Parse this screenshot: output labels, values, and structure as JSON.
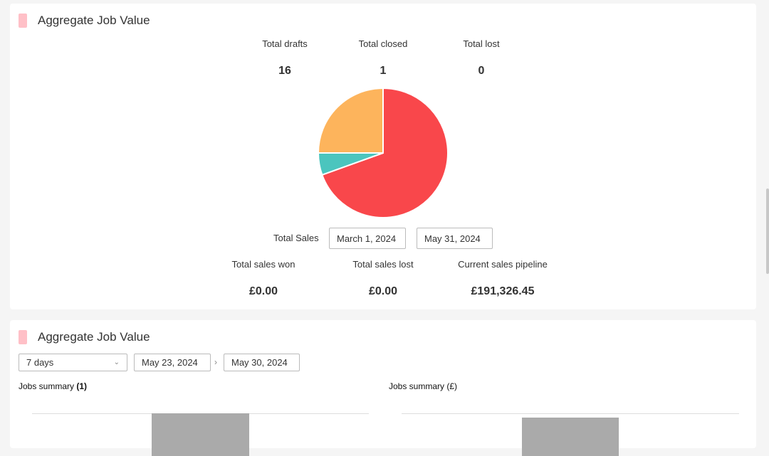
{
  "card1": {
    "title": "Aggregate Job Value",
    "stats": [
      {
        "label": "Total drafts",
        "value": "16"
      },
      {
        "label": "Total closed",
        "value": "1"
      },
      {
        "label": "Total lost",
        "value": "0"
      }
    ],
    "sales": {
      "label": "Total Sales",
      "start_date": "March 1, 2024",
      "end_date": "May 31, 2024"
    },
    "sales_stats": [
      {
        "label": "Total sales won",
        "value": "£0.00"
      },
      {
        "label": "Total sales lost",
        "value": "£0.00"
      },
      {
        "label": "Current sales pipeline",
        "value": "£191,326.45"
      }
    ]
  },
  "card2": {
    "title": "Aggregate Job Value",
    "range_select": "7 days",
    "start_date": "May 23, 2024",
    "end_date": "May 30, 2024",
    "separator": "›",
    "summary_left_label": "Jobs summary",
    "summary_left_count": "(1)",
    "summary_right_label": "Jobs summary (£)"
  },
  "colors": {
    "marker": "#ffc0c7",
    "pie_red": "#f9474b",
    "pie_teal": "#4bc5be",
    "pie_orange": "#fdb45c",
    "bar": "#aaaaaa"
  },
  "chart_data": {
    "type": "pie",
    "slices": [
      {
        "value": 69.5,
        "color": "#f9474b"
      },
      {
        "value": 5.5,
        "color": "#4bc5be"
      },
      {
        "value": 25.0,
        "color": "#fdb45c"
      }
    ],
    "start_angle_deg": -90,
    "order": [
      "red",
      "teal",
      "orange"
    ]
  }
}
